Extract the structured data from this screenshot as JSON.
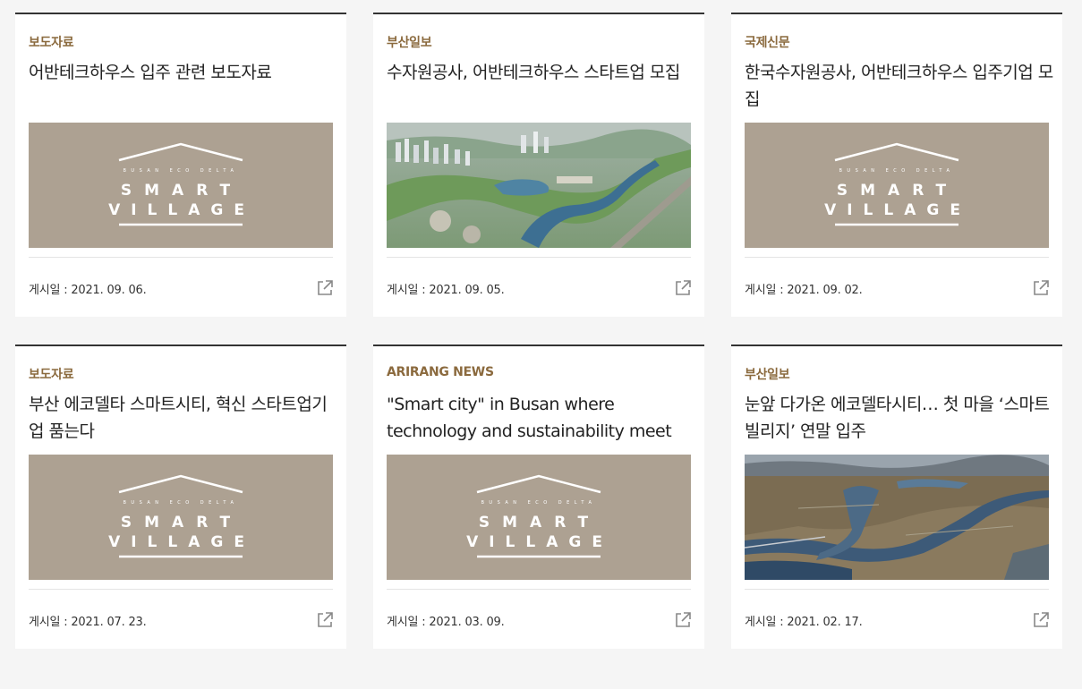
{
  "cards": [
    {
      "source": "보도자료",
      "title": "어반테크하우스 입주 관련 보도자료",
      "image": "smart-village-logo",
      "date": "게시일 : 2021. 09. 06."
    },
    {
      "source": "부산일보",
      "title": "수자원공사, 어반테크하우스 스타트업 모집",
      "image": "aerial-city-rendering",
      "date": "게시일 : 2021. 09. 05."
    },
    {
      "source": "국제신문",
      "title": "한국수자원공사, 어반테크하우스 입주기업 모집",
      "image": "smart-village-logo",
      "date": "게시일 : 2021. 09. 02."
    },
    {
      "source": "보도자료",
      "title": "부산 에코델타 스마트시티, 혁신 스타트업기업 품는다",
      "image": "smart-village-logo",
      "date": "게시일 : 2021. 07. 23."
    },
    {
      "source": "ARIRANG NEWS",
      "title": "\"Smart city\" in Busan where technology and sustainability meet",
      "image": "smart-village-logo",
      "date": "게시일 : 2021. 03. 09."
    },
    {
      "source": "부산일보",
      "title": "눈앞 다가온 에코델타시티… 첫 마을 ‘스마트빌리지’ 연말 입주",
      "image": "aerial-river-delta-photo",
      "date": "게시일 : 2021. 02. 17."
    }
  ],
  "logo": {
    "small_text": "BUSAN ECO DELTA",
    "line1": "SMART",
    "line2": "VILLAGE",
    "bg_color": "#ada192"
  },
  "colors": {
    "source": "#8b6a3e",
    "page_bg": "#f5f5f5",
    "card_border": "#333333"
  },
  "icons": {
    "external_link": "external-link-icon"
  }
}
